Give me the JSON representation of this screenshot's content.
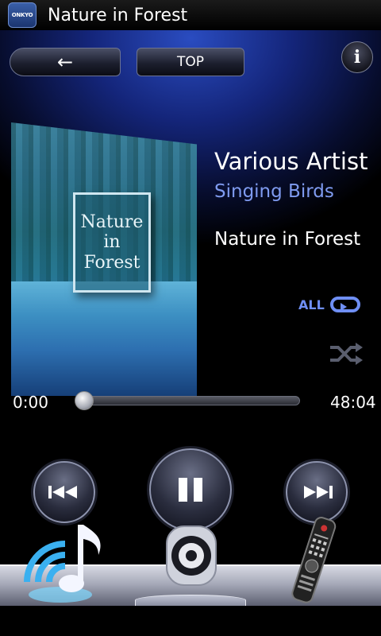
{
  "app": {
    "logo_text": "ONKYO",
    "title": "Nature in Forest"
  },
  "nav": {
    "back_icon": "arrow-left-icon",
    "top_label": "TOP",
    "info_label": "i"
  },
  "album_art": {
    "line1": "Nature",
    "line2": "in",
    "line3": "Forest"
  },
  "track": {
    "artist": "Various Artist",
    "album": "Singing Birds",
    "title": "Nature in Forest"
  },
  "modes": {
    "repeat_label": "ALL",
    "repeat_icon": "repeat-icon",
    "shuffle_icon": "shuffle-icon"
  },
  "progress": {
    "elapsed": "0:00",
    "total": "48:04",
    "fraction": 0.0
  },
  "transport": {
    "prev_icon": "skip-previous-icon",
    "pause_icon": "pause-icon",
    "next_icon": "skip-next-icon"
  },
  "dock": {
    "items": [
      {
        "icon": "music-network-icon"
      },
      {
        "icon": "speaker-icon"
      },
      {
        "icon": "remote-control-icon"
      }
    ]
  },
  "colors": {
    "accent": "#7f9bf0",
    "repeat": "#6f8ff5",
    "background_top": "#2a4cc0"
  }
}
